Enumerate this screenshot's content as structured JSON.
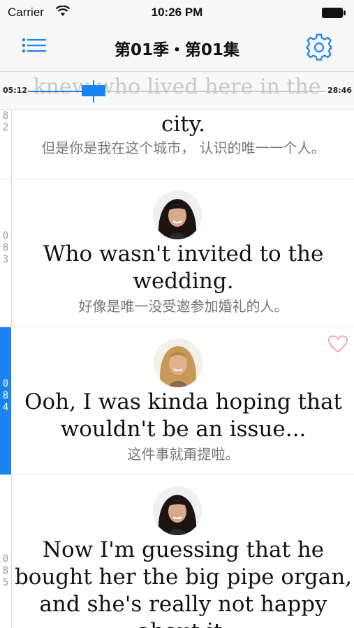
{
  "status_bar": {
    "carrier": "Carrier",
    "time": "10:26 PM"
  },
  "nav": {
    "title": "第01季・第01集",
    "menu_icon": "list-menu-icon",
    "settings_icon": "gear-icon"
  },
  "scrubber": {
    "ghost_text": "knew who lived here in the",
    "time_start": "05:12",
    "time_end": "28:46",
    "progress": 0.22
  },
  "rows": [
    {
      "number": "8\n2",
      "english": "city.",
      "chinese": "但是你是我在这个城市， 认识的唯一一个人。",
      "avatar": "none",
      "active": false
    },
    {
      "number": "0\n8\n3",
      "english": "Who wasn't invited to the wedding.",
      "chinese": "好像是唯一没受邀参加婚礼的人。",
      "avatar": "monica",
      "active": false
    },
    {
      "number": "0\n8\n4",
      "english": "Ooh, I was kinda hoping that wouldn't be an issue...",
      "chinese": "这件事就甭提啦。",
      "avatar": "rachel",
      "active": true,
      "favorite_icon": "heart-outline-icon"
    },
    {
      "number": "0\n8\n5",
      "english": "Now I'm guessing that he bought her the big pipe organ, and she's really not happy about it.",
      "chinese": "",
      "avatar": "monica",
      "active": false
    }
  ],
  "colors": {
    "accent": "#1a83f2",
    "heart": "#f2a0a6"
  }
}
